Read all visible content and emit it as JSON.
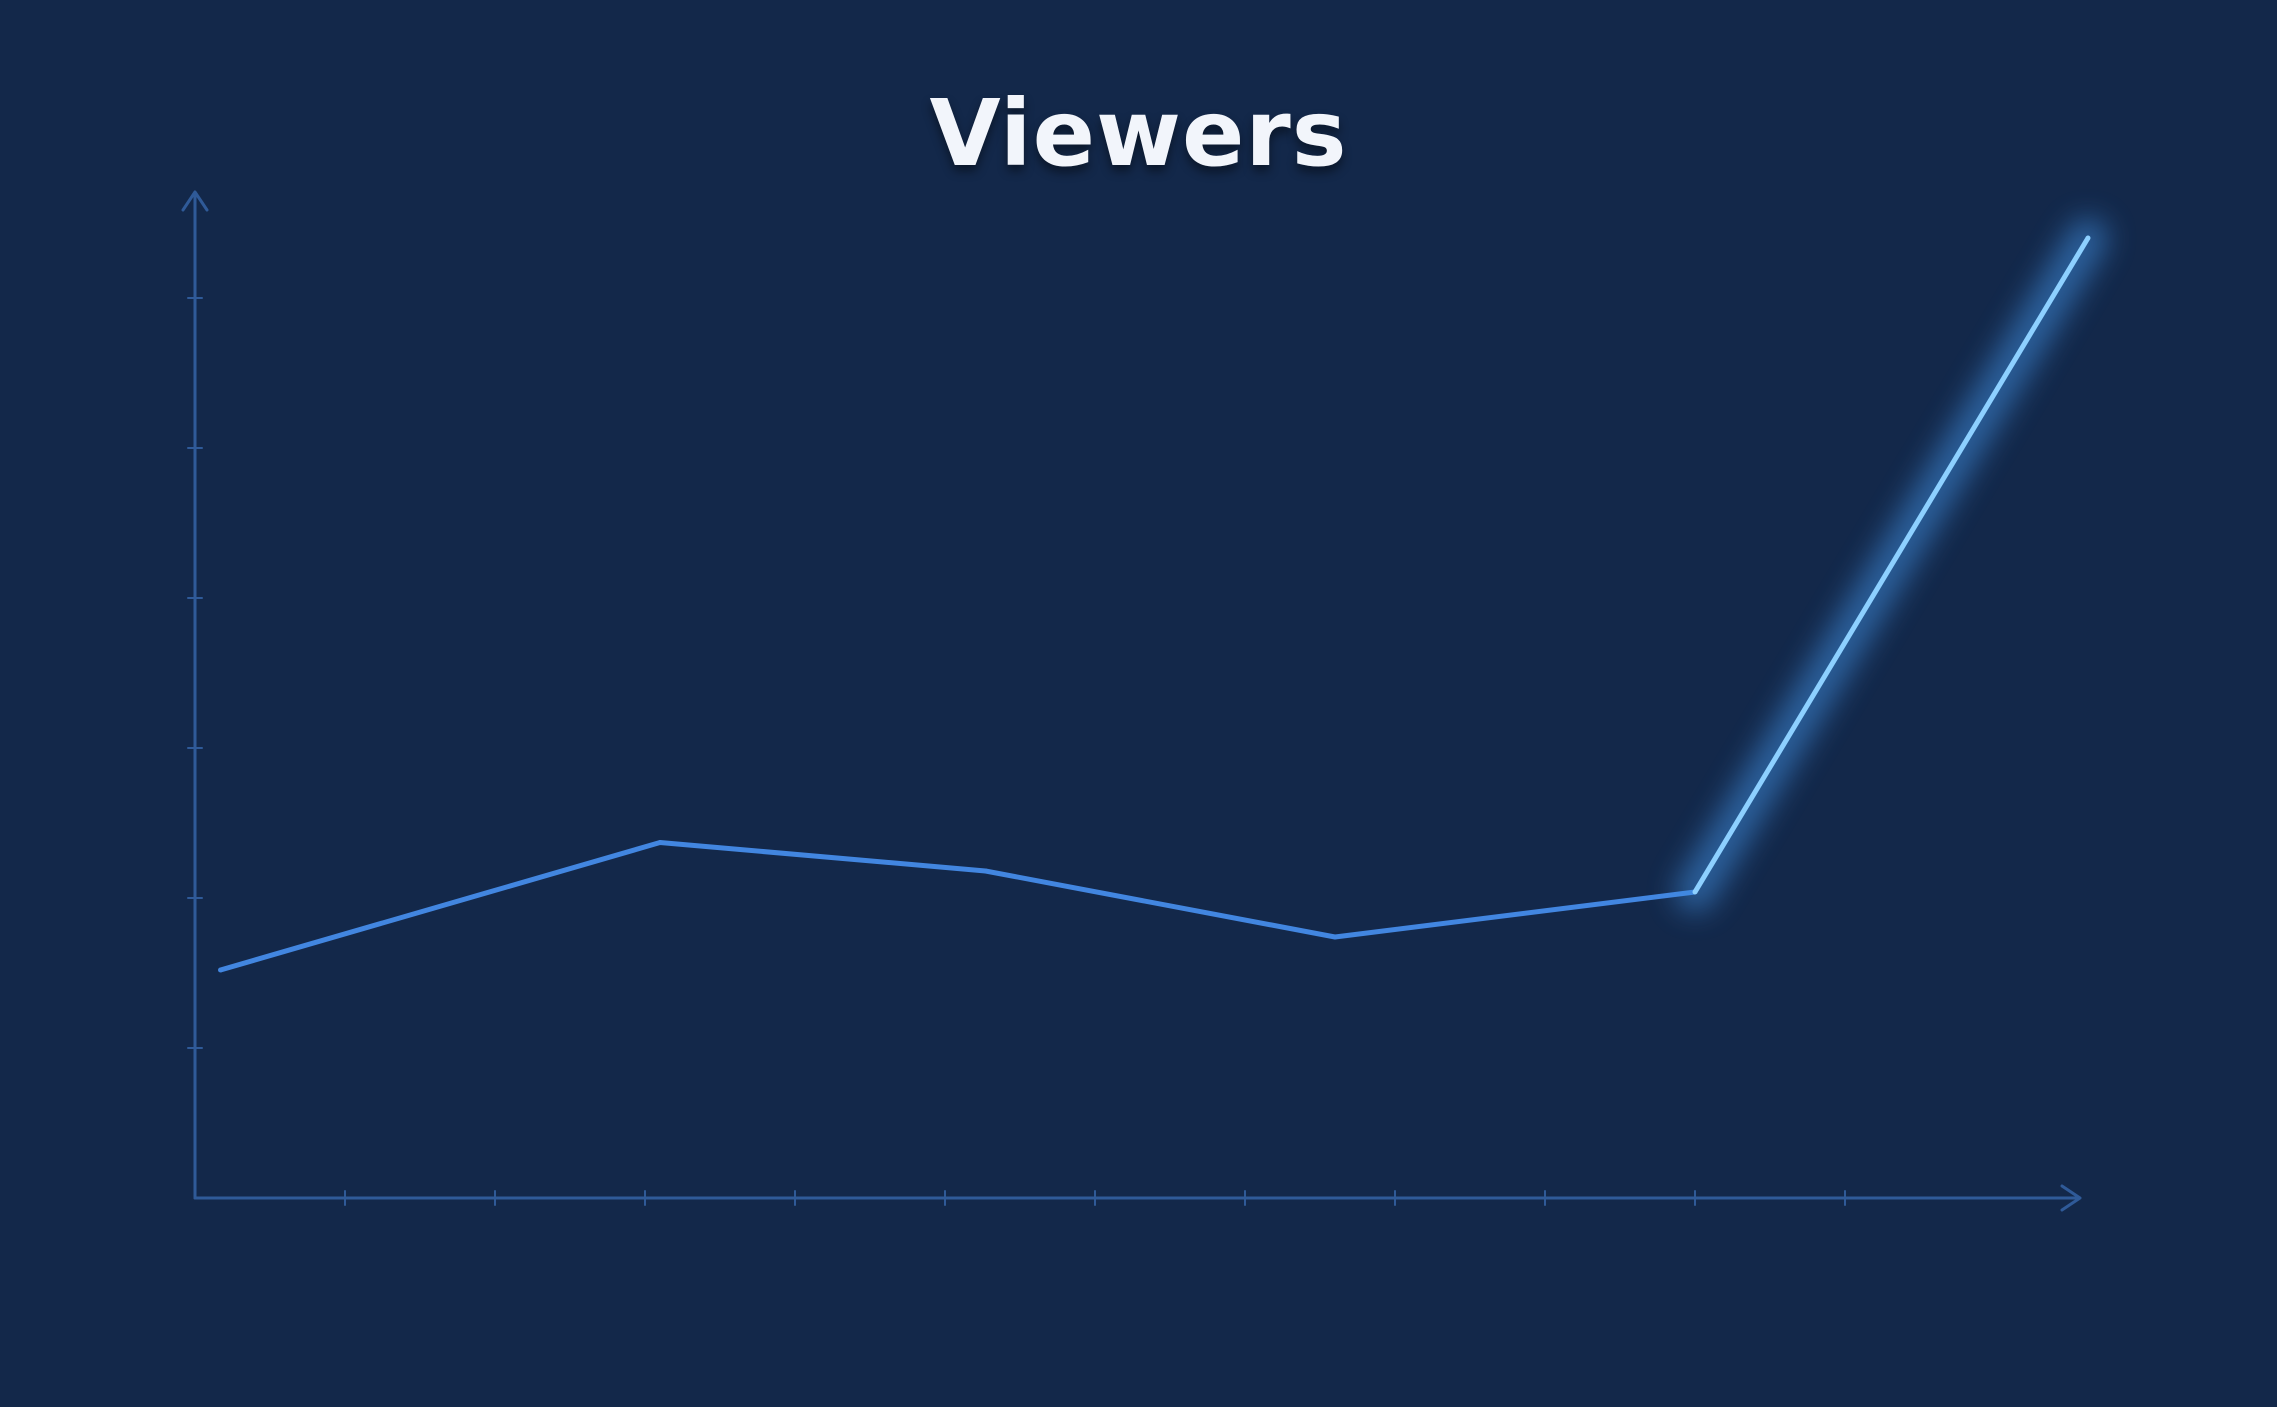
{
  "colors": {
    "background": "#13284a",
    "axis": "#2f5a98",
    "line": "#4286e0",
    "highlight": "#8dd0ff",
    "title": "#f2f5fb"
  },
  "chart_data": {
    "type": "line",
    "title": "Viewers",
    "xlabel": "",
    "ylabel": "",
    "x": [
      0.17,
      3.1,
      5.27,
      7.6,
      10,
      12.62
    ],
    "series": [
      {
        "values": [
          1.52,
          2.37,
          2.18,
          1.74,
          2.04,
          6.4
        ]
      }
    ],
    "highlighted_segment": [
      4,
      5
    ],
    "xlim": [
      0,
      12.5
    ],
    "ylim": [
      0,
      6.6
    ],
    "x_tick_count": 11,
    "y_tick_count": 6,
    "tick_labels": false,
    "grid": false,
    "legend": "none",
    "arrowheads": true
  }
}
